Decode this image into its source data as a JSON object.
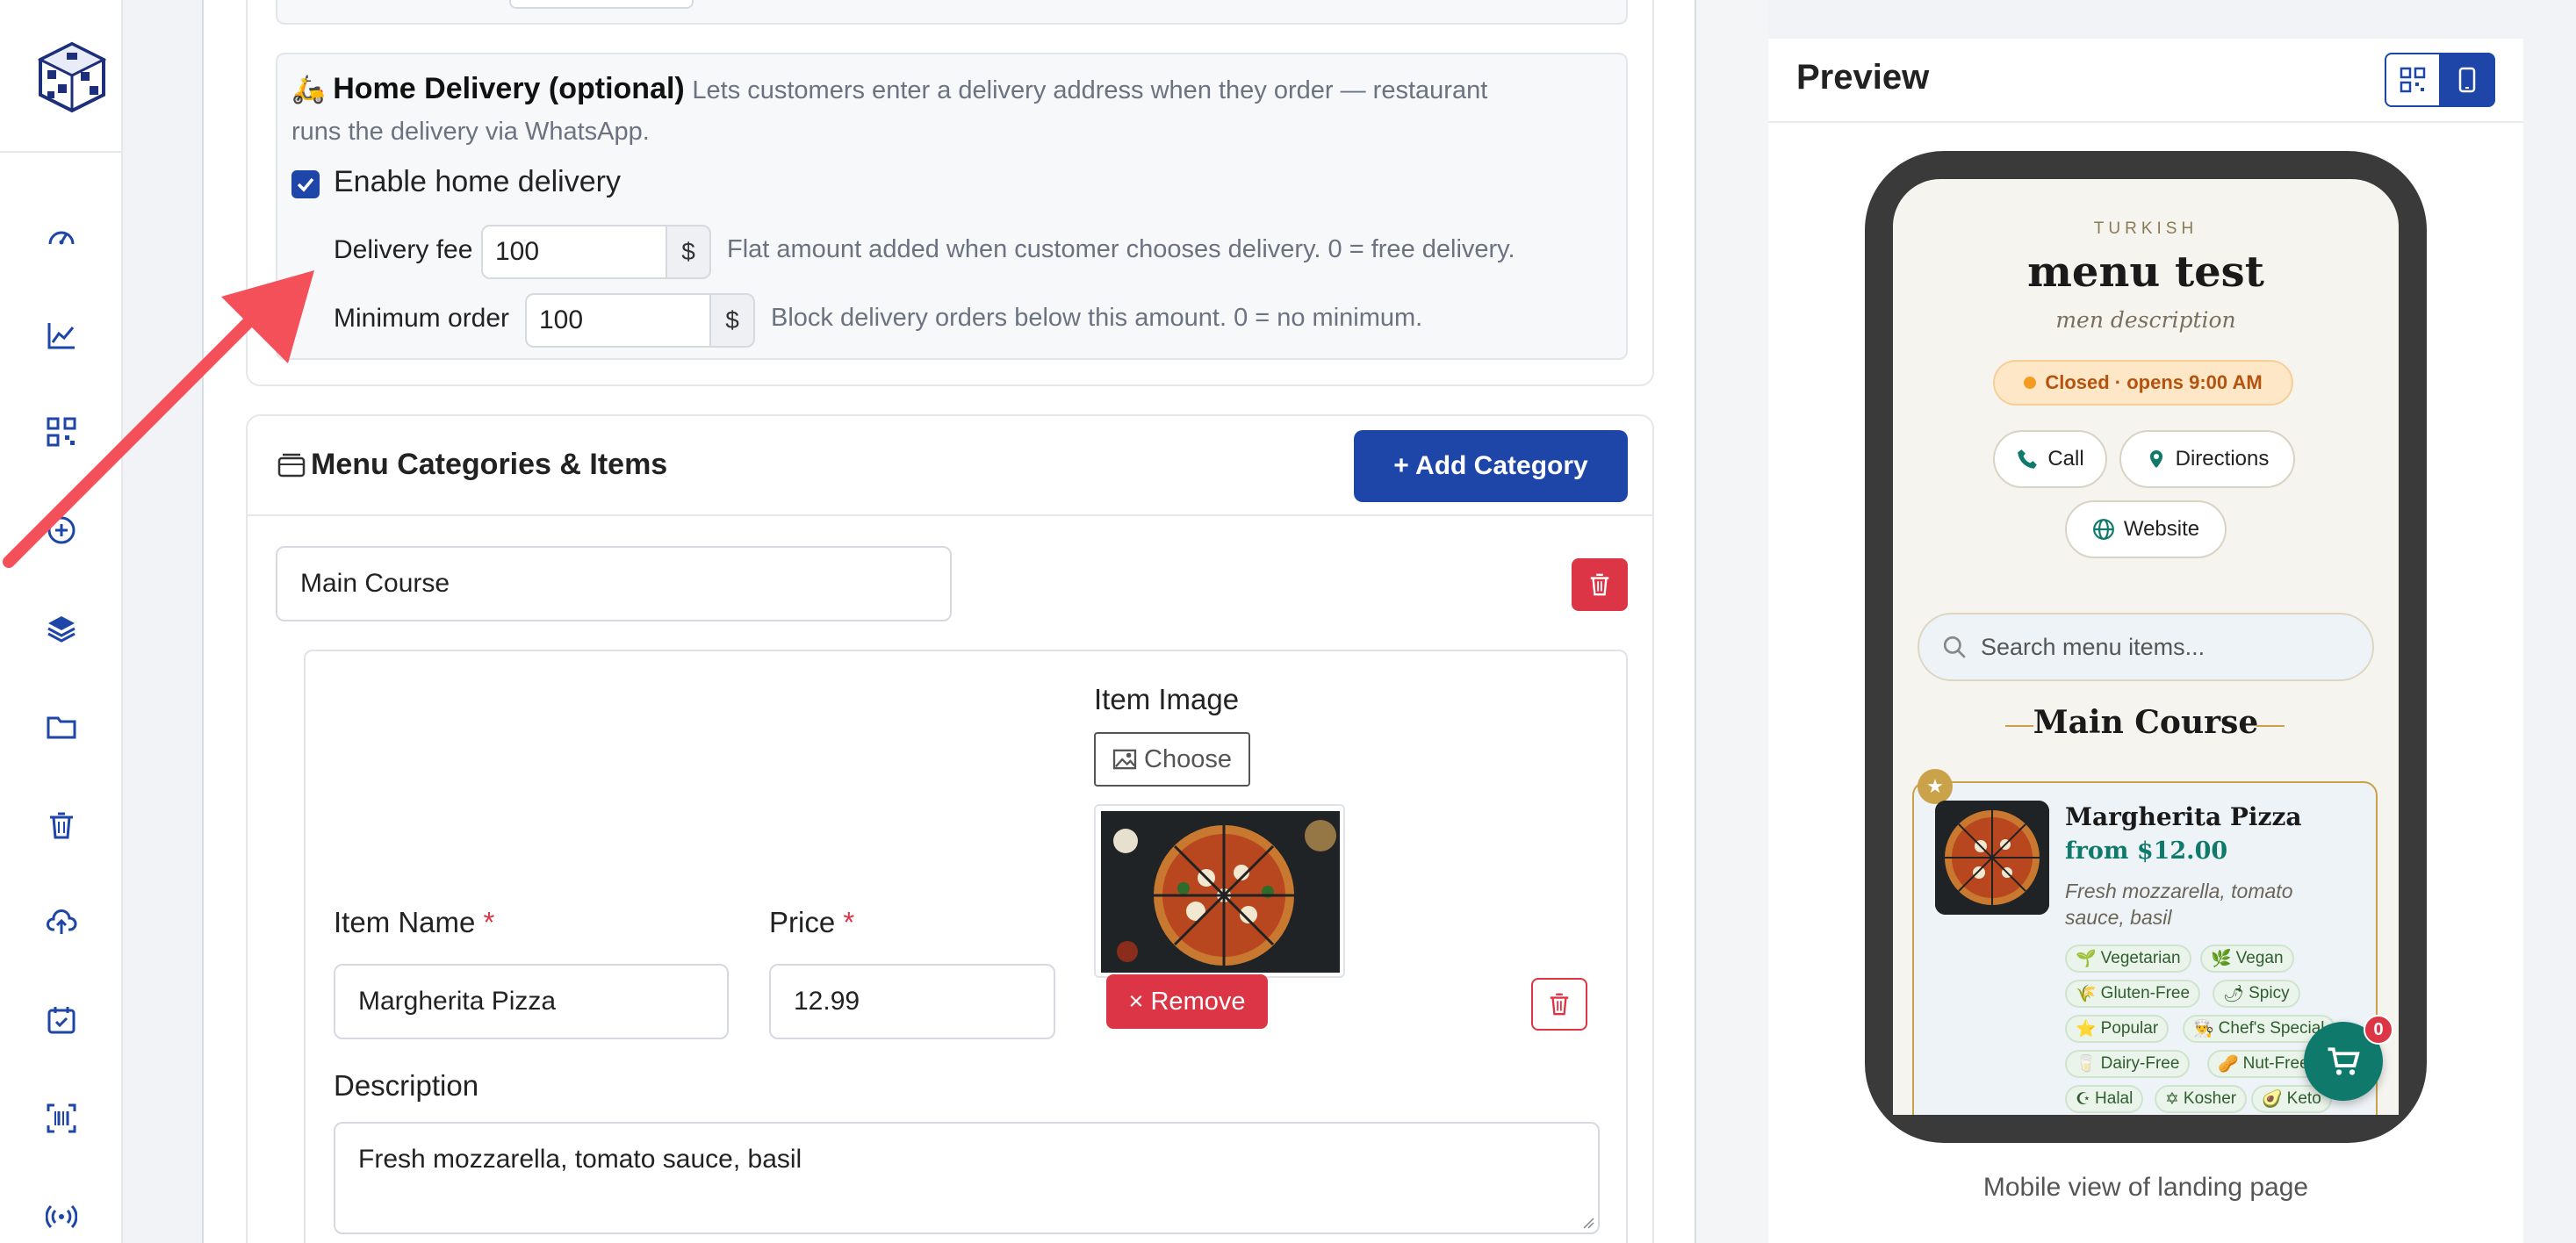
{
  "delivery": {
    "emoji": "🛵",
    "title": "Home Delivery (optional)",
    "desc_line1": "Lets customers enter a delivery address when they order — restaurant",
    "desc_line2": "runs the delivery via WhatsApp.",
    "enable_label": "Enable home delivery",
    "enabled": true,
    "fee_label": "Delivery fee",
    "fee_value": "100",
    "fee_currency": "$",
    "fee_help": "Flat amount added when customer chooses delivery. 0 = free delivery.",
    "min_label": "Minimum order",
    "min_value": "100",
    "min_currency": "$",
    "min_help": "Block delivery orders below this amount. 0 = no minimum."
  },
  "menu": {
    "section_title": "Menu Categories & Items",
    "add_category_label": "+ Add Category",
    "category_name": "Main Course",
    "item": {
      "image_label": "Item Image",
      "choose_label": "Choose",
      "remove_label": "× Remove",
      "name_label": "Item Name",
      "required_mark": "*",
      "name_value": "Margherita Pizza",
      "price_label": "Price",
      "price_value": "12.99",
      "description_label": "Description",
      "description_value": "Fresh mozzarella, tomato sauce, basil"
    }
  },
  "preview": {
    "title": "Preview",
    "caption": "Mobile view of landing page",
    "phone": {
      "cuisine": "TURKISH",
      "menu_title": "menu test",
      "menu_desc": "men description",
      "status": "Closed · opens 9:00 AM",
      "call": "Call",
      "directions": "Directions",
      "website": "Website",
      "search_placeholder": "Search menu items...",
      "section": "Main Course",
      "item_name": "Margherita Pizza",
      "item_price": "from $12.00",
      "item_desc_line1": "Fresh mozzarella, tomato",
      "item_desc_line2": "sauce, basil",
      "cart_count": "0",
      "tags": [
        {
          "icon": "🌱",
          "label": "Vegetarian"
        },
        {
          "icon": "🌿",
          "label": "Vegan"
        },
        {
          "icon": "🌾",
          "label": "Gluten-Free"
        },
        {
          "icon": "🌶",
          "label": "Spicy"
        },
        {
          "icon": "⭐",
          "label": "Popular"
        },
        {
          "icon": "👨‍🍳",
          "label": "Chef's Special"
        },
        {
          "icon": "🥛",
          "label": "Dairy-Free"
        },
        {
          "icon": "🥜",
          "label": "Nut-Free"
        },
        {
          "icon": "☪",
          "label": "Halal"
        },
        {
          "icon": "✡",
          "label": "Kosher"
        },
        {
          "icon": "🥑",
          "label": "Keto"
        }
      ]
    }
  },
  "colors": {
    "primary": "#1d46a8",
    "danger": "#dc3545",
    "teal": "#0f7a6c",
    "arrow": "#f4505a",
    "status_bg": "#fde7c7"
  }
}
